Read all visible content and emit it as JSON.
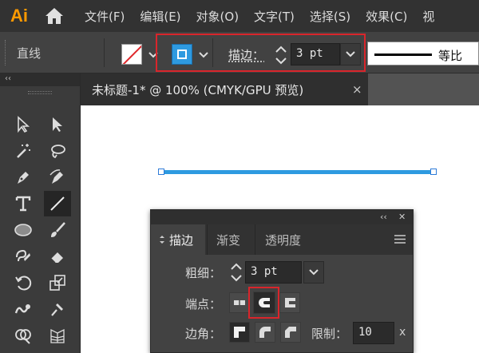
{
  "app": {
    "logo": "Ai"
  },
  "menu": [
    "文件(F)",
    "编辑(E)",
    "对象(O)",
    "文字(T)",
    "选择(S)",
    "效果(C)",
    "视"
  ],
  "control_bar": {
    "object_type": "直线",
    "stroke_label": "描边：",
    "stroke_weight": "3 pt",
    "profile_label": "等比",
    "fill_color": "#ffffff",
    "stroke_color": "#2e9ae0"
  },
  "document": {
    "tab_title": "未标题-1* @ 100% (CMYK/GPU 预览)",
    "close_glyph": "×",
    "line_color": "#2e9ae0"
  },
  "toolbar": {
    "collapse_glyph": "‹‹",
    "tools": [
      "direct-selection",
      "selection",
      "magic-wand",
      "lasso",
      "pen",
      "curvature",
      "type",
      "line-segment",
      "ellipse",
      "paintbrush",
      "shaper",
      "eraser",
      "rotate",
      "scale",
      "warp",
      "puppet-warp",
      "shape-builder",
      "perspective-grid"
    ],
    "active_tool": "line-segment"
  },
  "stroke_panel": {
    "collapse_glyph": "‹‹",
    "close_glyph": "✕",
    "tabs": [
      "描边",
      "渐变",
      "透明度"
    ],
    "active_tab": "描边",
    "weight_label": "粗细：",
    "weight_value": "3 pt",
    "cap_label": "端点：",
    "corner_label": "边角：",
    "limit_label": "限制：",
    "limit_value": "10",
    "limit_unit": "x",
    "selected_cap": "round-cap"
  },
  "highlight_color": "#d9252b"
}
